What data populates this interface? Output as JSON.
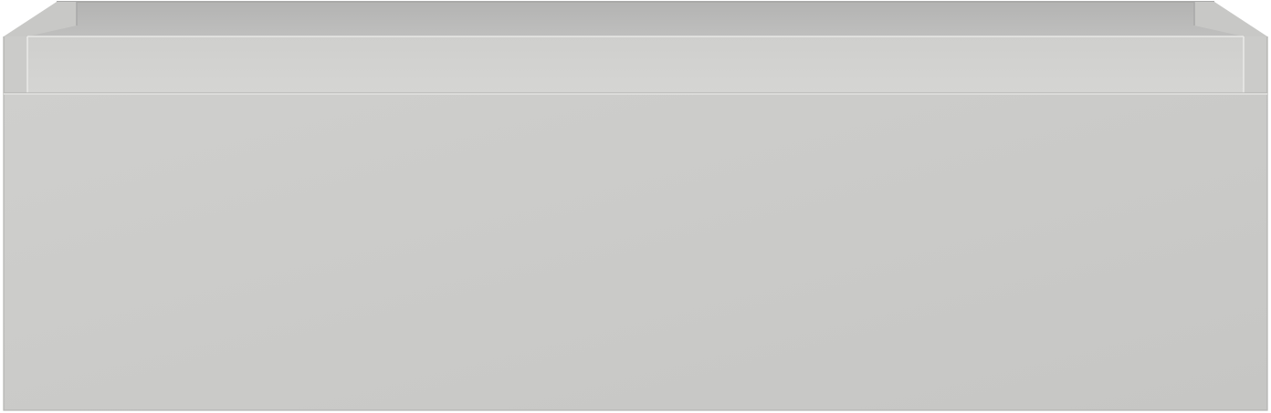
{
  "object": {
    "kind": "drawer-cabinet",
    "colors": {
      "background": "#ffffff",
      "front_panel": "#c9c9c7",
      "front_panel_light": "#cececc",
      "inner_back_wall": "#b9b9b8",
      "top_rim": "#d3d3d1",
      "side_wall_inner": "#c4c4c2",
      "edge_highlight": "#e6e6e4",
      "outline": "#aeaeac"
    }
  }
}
